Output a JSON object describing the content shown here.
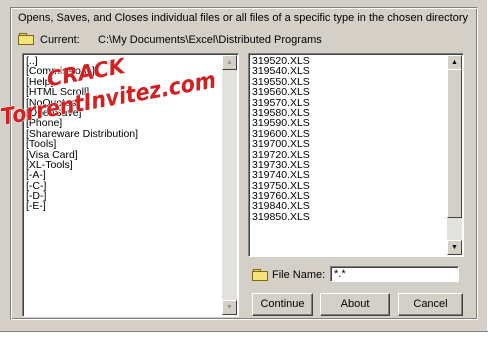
{
  "description": "Opens, Saves, and Closes individual files or all files of a specific type in the chosen directory",
  "directory": {
    "label": "Current:",
    "path": "C:\\My Documents\\Excel\\Distributed Programs"
  },
  "folders": {
    "items": [
      "[..]",
      "[Commissions]",
      "[Help]",
      "[HTML Scroll]",
      "[NoQuotes]",
      "[OpenSave]",
      "[Phone]",
      "[Shareware Distribution]",
      "[Tools]",
      "[Visa Card]",
      "[XL-Tools]",
      "[-A-]",
      "[-C-]",
      "[-D-]",
      "[-E-]"
    ]
  },
  "files": {
    "items": [
      "319520.XLS",
      "319540.XLS",
      "319550.XLS",
      "319560.XLS",
      "319570.XLS",
      "319580.XLS",
      "319590.XLS",
      "319600.XLS",
      "319700.XLS",
      "319720.XLS",
      "319730.XLS",
      "319740.XLS",
      "319750.XLS",
      "319760.XLS",
      "319840.XLS",
      "319850.XLS"
    ]
  },
  "filename": {
    "label": "File Name:",
    "value": "*.*"
  },
  "buttons": {
    "continue": "Continue",
    "about": "About",
    "cancel": "Cancel"
  },
  "watermark": {
    "line1": "CRACK",
    "line2": "TorrentInvitez.com"
  },
  "colors": {
    "dialog_bg": "#d4d0c8",
    "watermark_fill": "#d42020",
    "watermark_stroke": "#ffffff"
  }
}
